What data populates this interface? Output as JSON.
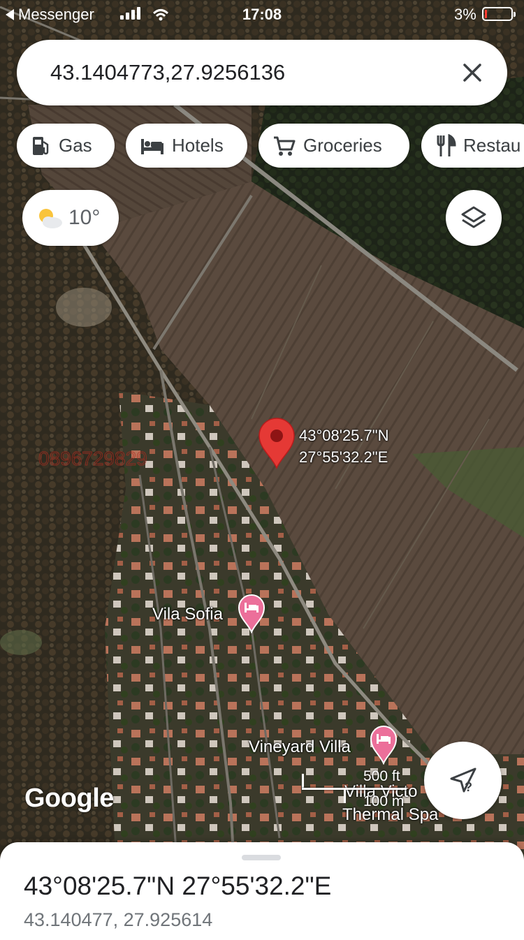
{
  "status_bar": {
    "back_app": "Messenger",
    "time": "17:08",
    "battery": "3%"
  },
  "search": {
    "query": "43.1404773,27.9256136",
    "close_icon": "close-icon"
  },
  "chips": [
    {
      "label": "Gas",
      "icon": "gas-station-icon"
    },
    {
      "label": "Hotels",
      "icon": "bed-icon"
    },
    {
      "label": "Groceries",
      "icon": "cart-icon"
    },
    {
      "label": "Restau",
      "icon": "restaurant-icon"
    }
  ],
  "weather": {
    "temperature": "10°",
    "icon": "partly-cloudy-icon"
  },
  "map": {
    "type": "satellite",
    "pin": {
      "lat_dms": "43°08'25.7\"N",
      "lon_dms": "27°55'32.2\"E",
      "color": "#e53935"
    },
    "watermark": "0896729829",
    "places": [
      {
        "name": "Vila Sofia",
        "icon": "hotel-icon",
        "color": "#ec6f9a"
      },
      {
        "name": "Vineyard Villa",
        "icon": "hotel-icon",
        "color": "#ec6f9a"
      },
      {
        "name": "Villa Victo",
        "icon": "hotel-icon",
        "color": "#ec6f9a"
      },
      {
        "name": "Thermal Spa",
        "icon": "hotel-icon",
        "color": "#ec6f9a"
      }
    ],
    "scale": {
      "imperial": "500 ft",
      "metric": "100 m"
    },
    "logo": "Google"
  },
  "bottom_sheet": {
    "title": "43°08'25.7\"N 27°55'32.2\"E",
    "subtitle": "43.140477, 27.925614"
  }
}
